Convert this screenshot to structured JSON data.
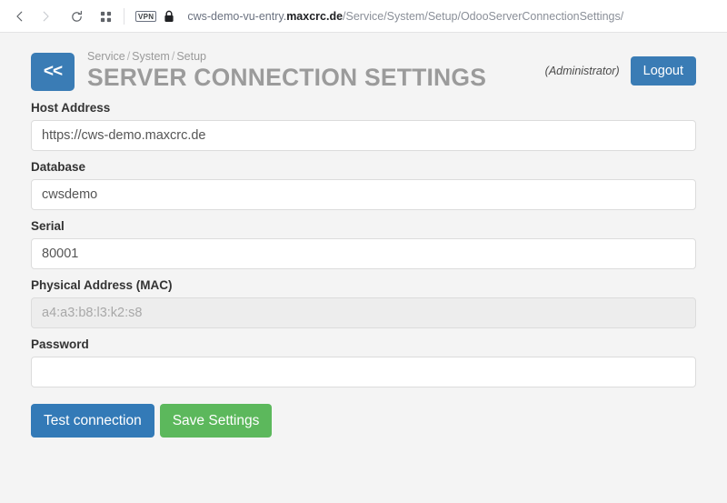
{
  "browser": {
    "back_icon": "back-arrow-icon",
    "forward_icon": "forward-arrow-icon",
    "reload_icon": "reload-icon",
    "apps_icon": "grid-apps-icon",
    "vpn_badge": "VPN",
    "lock_icon": "lock-icon",
    "url": {
      "prefix": "cws-demo-vu-entry.",
      "host": "maxcrc.de",
      "path": "/Service/System/Setup/OdooServerConnectionSettings/"
    }
  },
  "header": {
    "back_label": "<<",
    "breadcrumb": [
      "Service",
      "System",
      "Setup"
    ],
    "breadcrumb_separator": "/",
    "title": "SERVER CONNECTION SETTINGS",
    "user_label": "(Administrator)",
    "logout_label": "Logout"
  },
  "form": {
    "fields": [
      {
        "name": "host-address",
        "label": "Host Address",
        "value": "https://cws-demo.maxcrc.de",
        "placeholder": "",
        "type": "text",
        "disabled": false
      },
      {
        "name": "database",
        "label": "Database",
        "value": "cwsdemo",
        "placeholder": "",
        "type": "text",
        "disabled": false
      },
      {
        "name": "serial",
        "label": "Serial",
        "value": "80001",
        "placeholder": "",
        "type": "text",
        "disabled": false
      },
      {
        "name": "physical-address-mac",
        "label": "Physical Address (MAC)",
        "value": "a4:a3:b8:l3:k2:s8",
        "placeholder": "a4:a3:b8:l3:k2:s8",
        "type": "text",
        "disabled": true
      },
      {
        "name": "password",
        "label": "Password",
        "value": "",
        "placeholder": "",
        "type": "password",
        "disabled": false
      }
    ]
  },
  "actions": {
    "test_connection_label": "Test connection",
    "save_settings_label": "Save Settings"
  },
  "colors": {
    "primary": "#337ab7",
    "header_blue": "#3a7cb5",
    "success": "#5cb85c",
    "page_bg": "#f4f4f4",
    "title_gray": "#9b9b9b"
  }
}
